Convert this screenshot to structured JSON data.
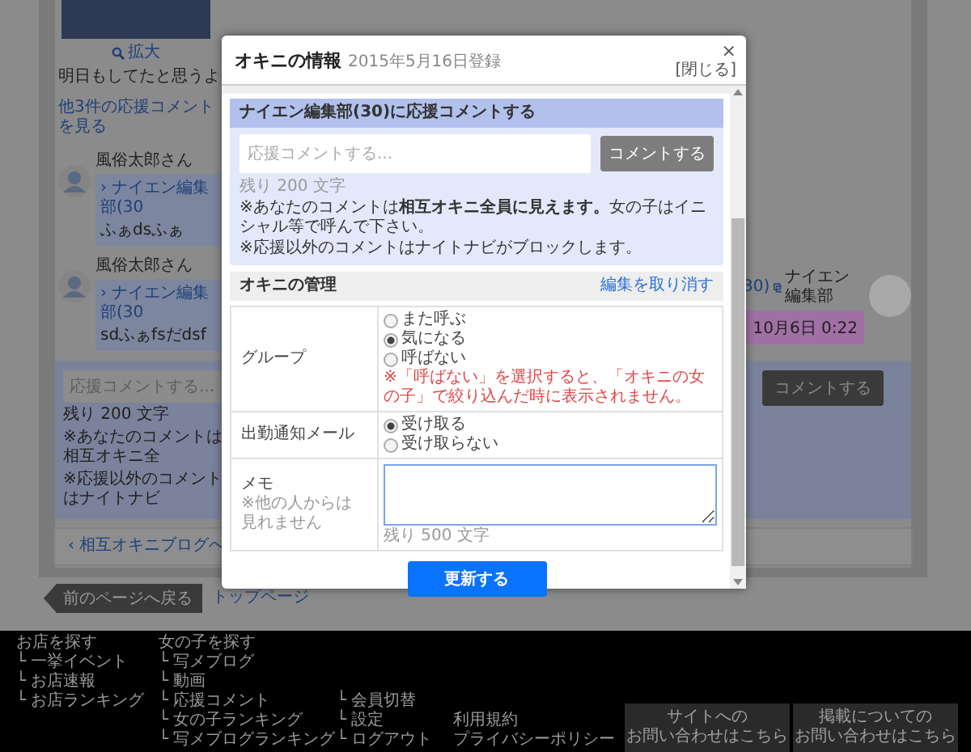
{
  "page": {
    "photo_zoom": "拡大",
    "post_text": "明日もしてたと思うよ",
    "more_comments": "他3件の応援コメントを見る",
    "comments": [
      {
        "author": "風俗太郎さん",
        "to": "› ナイエン編集部(30",
        "text": "ふぁdsふぁ"
      },
      {
        "author": "風俗太郎さん",
        "to": "› ナイエン編集部(30",
        "text": "sdふぁfsだdsf"
      }
    ],
    "reply": {
      "to": "30)",
      "author": "ナイエン編集部",
      "time": "10月6日 0:22"
    },
    "comment_form": {
      "placeholder": "応援コメントする...",
      "button": "コメントする",
      "remaining": "残り 200 文字",
      "notes": [
        "※あなたのコメントは相互オキニ全",
        "※応援以外のコメントはナイトナビ"
      ]
    },
    "back_link": "‹ 相互オキニブログへ",
    "nav": {
      "back_button": "前のページへ戻る",
      "top_link": "トップページ"
    }
  },
  "footer": {
    "columns": [
      [
        "お店を探す",
        "└ 一挙イベント",
        "└ お店速報",
        "└ お店ランキング"
      ],
      [
        "女の子を探す",
        "└ 写メブログ",
        "└ 動画",
        "└ 応援コメント",
        "└ 女の子ランキング",
        "└ 写メブログランキング"
      ],
      [
        "└ 会員切替",
        "└ 設定",
        "└ ログアウト"
      ],
      [
        "利用規約",
        "プライバシーポリシー"
      ]
    ],
    "contact_buttons": [
      [
        "サイトへの",
        "お問い合わせはこちら"
      ],
      [
        "掲載についての",
        "お問い合わせはこちら"
      ]
    ]
  },
  "modal": {
    "title": "オキニの情報",
    "registered": "2015年5月16日登録",
    "close_icon": "×",
    "close_label": "[閉じる]",
    "comment_section": {
      "heading": "ナイエン編集部(30)に応援コメントする",
      "placeholder": "応援コメントする...",
      "button": "コメントする",
      "remaining": "残り 200 文字",
      "notes": [
        "※あなたのコメントは**相互オキニ全員に見えます。**女の子はイニシャル等で呼んで下さい。",
        "※応援以外のコメントはナイトナビがブロックします。"
      ]
    },
    "manage": {
      "heading": "オキニの管理",
      "cancel_link": "編集を取り消す",
      "rows": [
        {
          "kind": "radio",
          "label": "グループ",
          "options": [
            {
              "label": "また呼ぶ",
              "selected": false
            },
            {
              "label": "気になる",
              "selected": true
            },
            {
              "label": "呼ばない",
              "selected": false
            }
          ],
          "warning": "※「呼ばない」を選択すると、「オキニの女の子」で絞り込んだ時に表示されません。"
        },
        {
          "kind": "radio",
          "label": "出勤通知メール",
          "options": [
            {
              "label": "受け取る",
              "selected": true
            },
            {
              "label": "受け取らない",
              "selected": false
            }
          ]
        },
        {
          "kind": "memo",
          "label": "メモ",
          "sublabel": "※他の人からは見れません",
          "remaining": "残り 500 文字",
          "focused": true
        }
      ]
    },
    "submit": "更新する"
  }
}
